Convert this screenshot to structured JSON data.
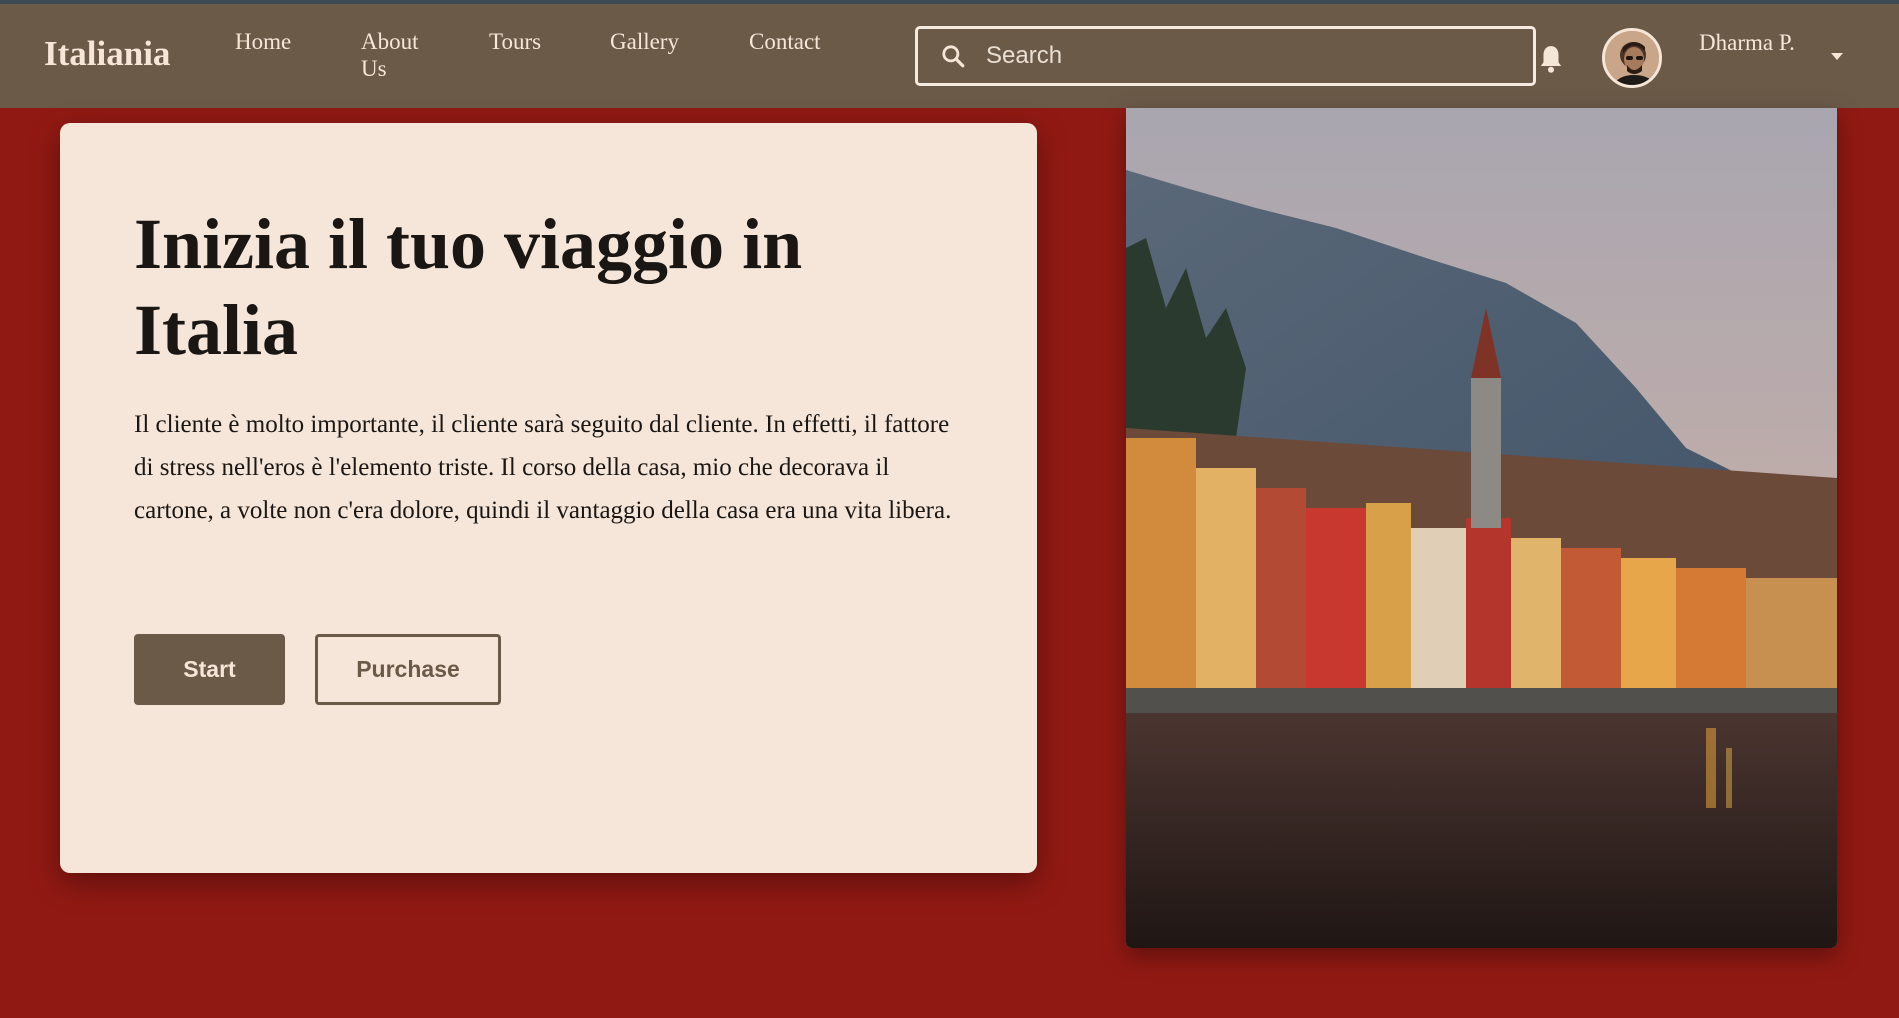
{
  "header": {
    "brand": "Italiania",
    "nav": [
      "Home",
      "About Us",
      "Tours",
      "Gallery",
      "Contact"
    ],
    "search_placeholder": "Search",
    "user_name": "Dharma P."
  },
  "hero": {
    "title": "Inizia il tuo viaggio in Italia",
    "description": "Il cliente è molto importante, il cliente sarà seguito dal cliente. In effetti, il fattore di stress nell'eros è l'elemento triste. Il corso della casa, mio che decorava il cartone, a volte non c'era dolore, quindi il vantaggio della casa era una vita libera.",
    "start_label": "Start",
    "purchase_label": "Purchase"
  },
  "icons": {
    "search": "search-icon",
    "notifications": "bell-icon",
    "user_menu": "caret-down-icon"
  },
  "colors": {
    "navbar": "#6c5a49",
    "page_background": "#911913",
    "card_background": "#f5e6d9",
    "text_light": "#f5e6d8",
    "text_dark": "#1a1614"
  }
}
